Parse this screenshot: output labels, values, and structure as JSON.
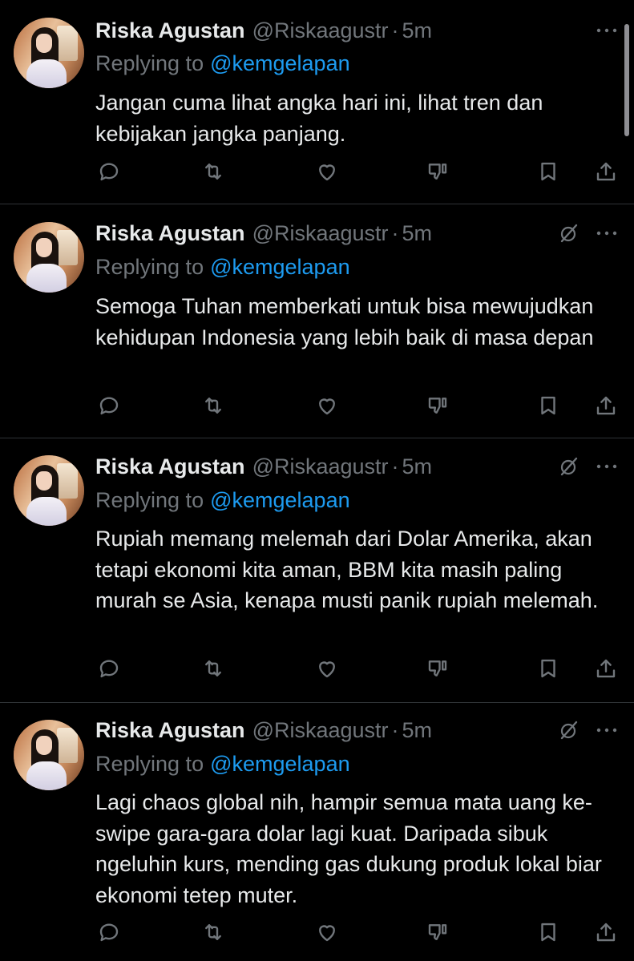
{
  "tweets": [
    {
      "display_name": "Riska Agustan",
      "handle": "@Riskaagustr",
      "separator": "·",
      "time": "5m",
      "replying_to_label": "Replying to",
      "replying_to_handle": "@kemgelapan",
      "text": "Jangan cuma lihat angka hari ini, lihat tren dan kebijakan jangka panjang.",
      "show_grok": false
    },
    {
      "display_name": "Riska Agustan",
      "handle": "@Riskaagustr",
      "separator": "·",
      "time": "5m",
      "replying_to_label": "Replying to",
      "replying_to_handle": "@kemgelapan",
      "text": "Semoga Tuhan memberkati untuk bisa mewujudkan kehidupan Indonesia yang lebih baik di masa depan",
      "show_grok": true
    },
    {
      "display_name": "Riska Agustan",
      "handle": "@Riskaagustr",
      "separator": "·",
      "time": "5m",
      "replying_to_label": "Replying to",
      "replying_to_handle": "@kemgelapan",
      "text": "Rupiah memang melemah dari Dolar Amerika, akan tetapi ekonomi kita aman, BBM kita masih paling murah se Asia, kenapa musti panik rupiah melemah.",
      "show_grok": true
    },
    {
      "display_name": "Riska Agustan",
      "handle": "@Riskaagustr",
      "separator": "·",
      "time": "5m",
      "replying_to_label": "Replying to",
      "replying_to_handle": "@kemgelapan",
      "text": "Lagi chaos global nih, hampir semua mata uang ke-swipe gara-gara dolar lagi kuat. Daripada sibuk ngeluhin kurs, mending gas dukung produk lokal biar ekonomi tetep muter.",
      "show_grok": true
    }
  ],
  "action_icons": [
    "reply-icon",
    "repost-icon",
    "like-icon",
    "dislike-icon",
    "bookmark-icon",
    "share-icon"
  ],
  "colors": {
    "background": "#000000",
    "primary_text": "#e7e9ea",
    "secondary_text": "#71767b",
    "accent": "#1d9bf0",
    "divider": "#2f3336"
  }
}
